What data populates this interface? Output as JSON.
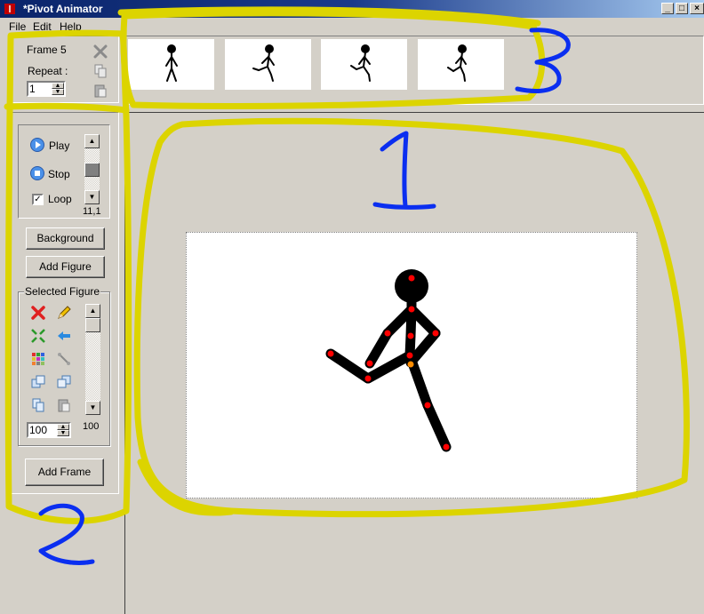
{
  "window": {
    "title": "*Pivot Animator"
  },
  "menu": [
    {
      "label": "File"
    },
    {
      "label": "Edit"
    },
    {
      "label": "Help"
    }
  ],
  "frame_panel": {
    "frame_label": "Frame 5",
    "repeat_label": "Repeat :",
    "repeat_value": "1"
  },
  "playback": {
    "play_label": "Play",
    "stop_label": "Stop",
    "loop_label": "Loop",
    "loop_checked": true,
    "speed_readout": "11,1"
  },
  "buttons": {
    "background": "Background",
    "add_figure": "Add Figure",
    "add_frame": "Add Frame"
  },
  "selected_figure": {
    "title": "Selected Figure",
    "scale_value": "100",
    "scale_readout": "100"
  },
  "timeline": {
    "frames": [
      "frame-1",
      "frame-2",
      "frame-3",
      "frame-4"
    ]
  },
  "annotations": {
    "label_1": "1",
    "label_2": "2",
    "label_3": "3"
  },
  "colors": {
    "highlight": "#dcd400",
    "annotation_blue": "#0a2ef0",
    "joint_red": "#ff0000",
    "joint_orange": "#ff8c00",
    "figure": "#000000"
  }
}
